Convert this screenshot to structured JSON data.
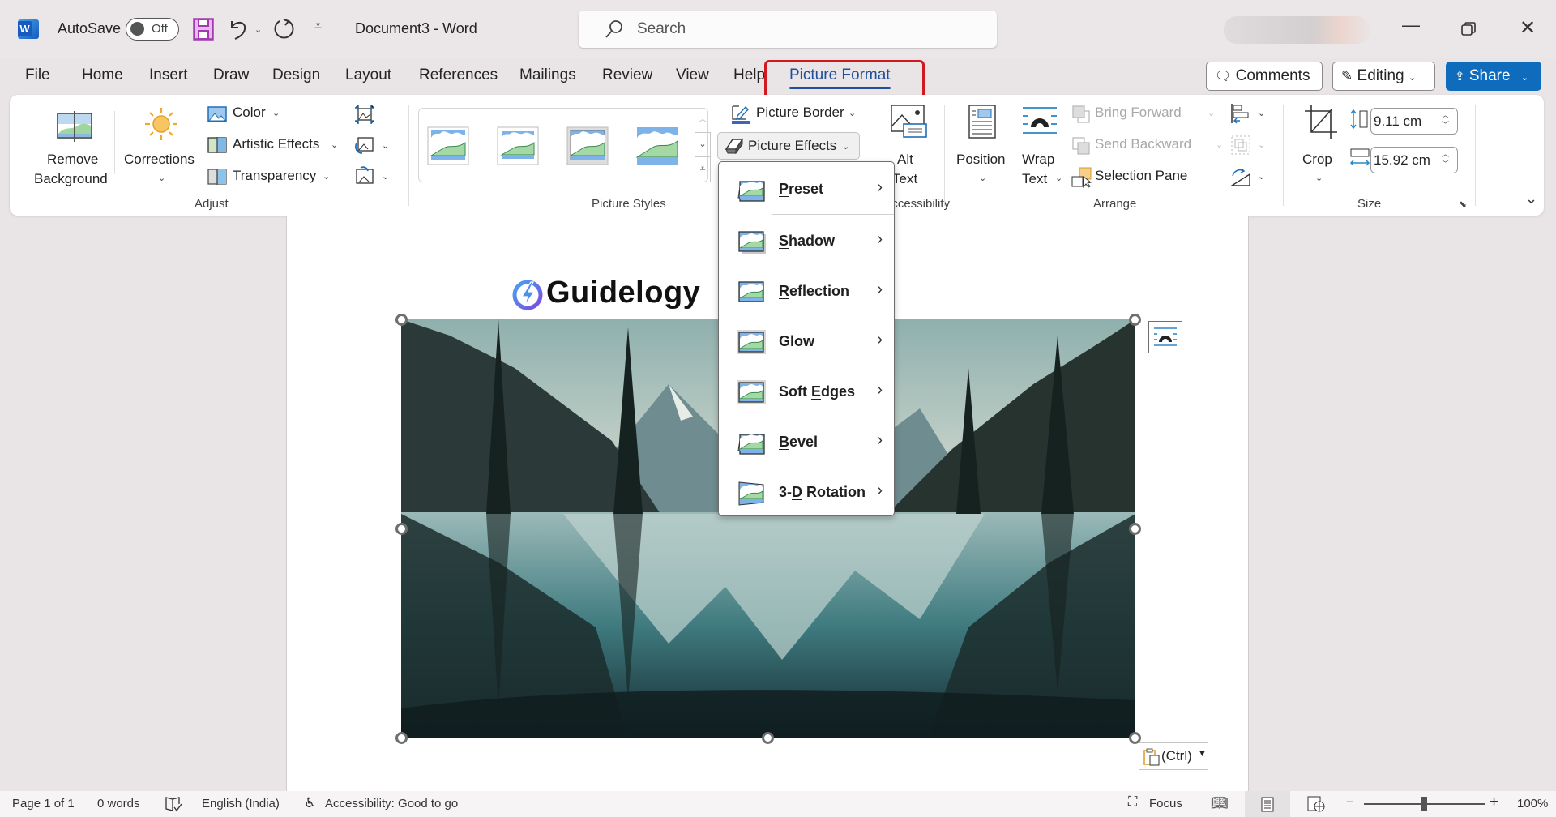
{
  "titlebar": {
    "app_icon": "word-icon",
    "autosave_label": "AutoSave",
    "autosave_state": "Off",
    "save_icon": "save-icon",
    "undo_icon": "undo-icon",
    "redo_icon": "redo-icon",
    "customize_icon": "customize-quick-access-icon",
    "document_title": "Document3  -  Word",
    "search_placeholder": "Search",
    "window_controls": [
      "minimize-icon",
      "restore-icon",
      "close-icon"
    ]
  },
  "tabs": [
    {
      "label": "File"
    },
    {
      "label": "Home"
    },
    {
      "label": "Insert"
    },
    {
      "label": "Draw"
    },
    {
      "label": "Design"
    },
    {
      "label": "Layout"
    },
    {
      "label": "References"
    },
    {
      "label": "Mailings"
    },
    {
      "label": "Review"
    },
    {
      "label": "View"
    },
    {
      "label": "Help"
    },
    {
      "label": "Picture Format",
      "active": true
    }
  ],
  "header_buttons": {
    "comments": "Comments",
    "editing": "Editing",
    "share": "Share"
  },
  "ribbon": {
    "adjust": {
      "group_label": "Adjust",
      "remove_background": [
        "Remove",
        "Background"
      ],
      "corrections": "Corrections",
      "color": "Color",
      "artistic_effects": "Artistic Effects",
      "transparency": "Transparency"
    },
    "picture_styles": {
      "group_label": "Picture Styles",
      "picture_border": "Picture Border",
      "picture_effects": "Picture Effects"
    },
    "accessibility": {
      "group_label": "Accessibility",
      "alt_text": [
        "Alt",
        "Text"
      ]
    },
    "arrange": {
      "group_label": "Arrange",
      "position": "Position",
      "wrap_text": [
        "Wrap",
        "Text"
      ],
      "bring_forward": "Bring Forward",
      "send_backward": "Send Backward",
      "selection_pane": "Selection Pane"
    },
    "size": {
      "group_label": "Size",
      "crop": "Crop",
      "height": "9.11 cm",
      "width": "15.92 cm"
    }
  },
  "picture_effects_menu": [
    {
      "label": "Preset",
      "accel_index": 0
    },
    {
      "label": "Shadow",
      "accel_index": 0
    },
    {
      "label": "Reflection",
      "accel_index": 0
    },
    {
      "label": "Glow",
      "accel_index": 0
    },
    {
      "label": "Soft Edges",
      "accel_index": 5
    },
    {
      "label": "Bevel",
      "accel_index": 0
    },
    {
      "label": "3-D Rotation",
      "accel_index": 2
    }
  ],
  "document": {
    "logo_text": "Guidelogy",
    "paste_options": "(Ctrl)"
  },
  "status": {
    "page": "Page 1 of 1",
    "words": "0 words",
    "language": "English (India)",
    "accessibility": "Accessibility: Good to go",
    "focus": "Focus",
    "zoom": "100%",
    "zoom_value_percent": 100
  },
  "colors": {
    "accent": "#1f4e9c",
    "share": "#0f6cbd",
    "highlight_box": "#d11a20"
  }
}
